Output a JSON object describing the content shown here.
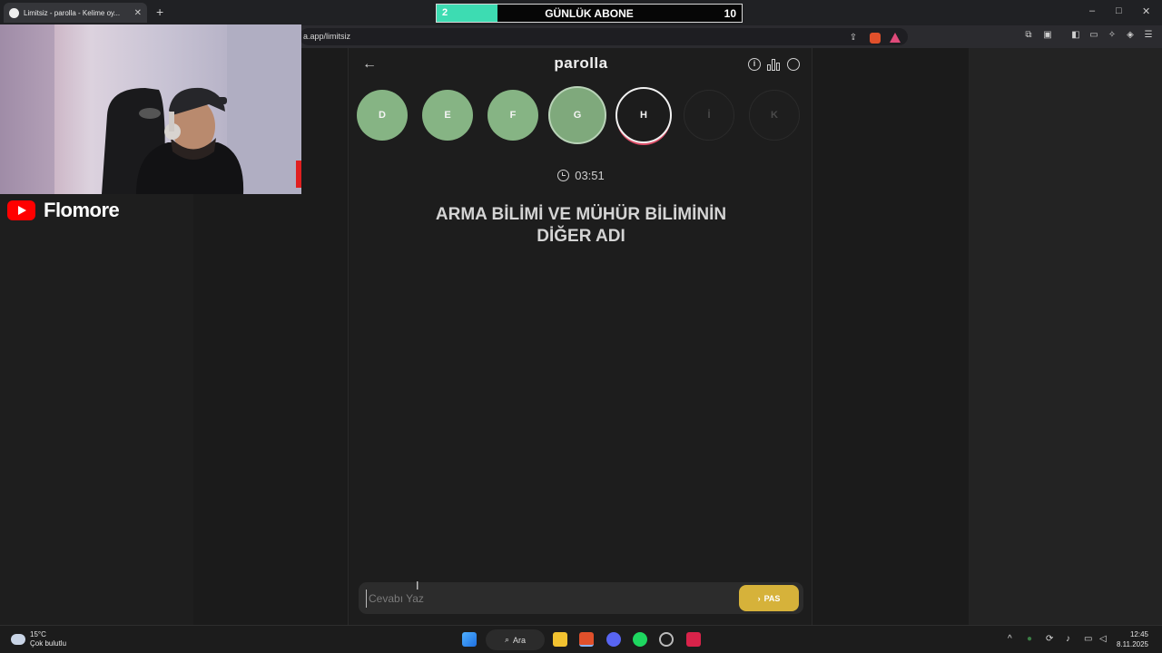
{
  "browser": {
    "tab_title": "Limitsiz - parolla - Kelime oy...",
    "new_tab": "+",
    "url": "a.app/limitsiz",
    "window_controls": [
      "–",
      "□",
      "✕"
    ]
  },
  "overlay": {
    "subs_current": "2",
    "subs_label": "GÜNLÜK ABONE",
    "subs_goal": "10",
    "subs_progress": 0.2,
    "channel": "Flomore"
  },
  "app": {
    "title": "parolla",
    "letters": [
      {
        "letter": "D",
        "state": "done"
      },
      {
        "letter": "E",
        "state": "done"
      },
      {
        "letter": "F",
        "state": "done"
      },
      {
        "letter": "G",
        "state": "done"
      },
      {
        "letter": "H",
        "state": "current"
      },
      {
        "letter": "İ",
        "state": "pending"
      },
      {
        "letter": "K",
        "state": "pending"
      }
    ],
    "timer": "03:51",
    "question_line1": "ARMA BİLİMİ VE MÜHÜR BİLİMİNİN",
    "question_line2": "DİĞER ADI",
    "answer_placeholder": "Cevabı Yaz",
    "pass_label": "PAS"
  },
  "taskbar": {
    "temperature": "15°C",
    "weather": "Çok bulutlu",
    "search": "Ara",
    "time": "12:45",
    "date": "8.11.2025"
  },
  "colors": {
    "correct": "#86b484",
    "pass_button": "#d6b23a",
    "subs_fill": "#3ddcb2",
    "current_ring": "#e0506a"
  }
}
